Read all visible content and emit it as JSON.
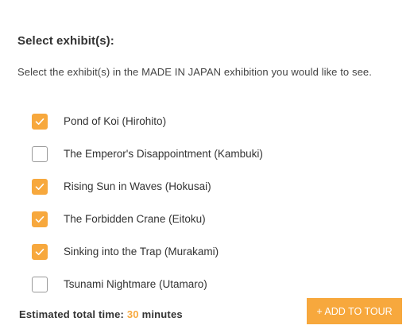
{
  "header": {
    "title": "Select exhibit(s):",
    "description": "Select the exhibit(s) in the MADE IN JAPAN exhibition you would like to see."
  },
  "exhibits": [
    {
      "label": "Pond of Koi (Hirohito)",
      "checked": true
    },
    {
      "label": "The Emperor's Disappointment (Kambuki)",
      "checked": false
    },
    {
      "label": "Rising Sun in Waves (Hokusai)",
      "checked": true
    },
    {
      "label": "The Forbidden Crane (Eitoku)",
      "checked": true
    },
    {
      "label": "Sinking into the Trap (Murakami)",
      "checked": true
    },
    {
      "label": "Tsunami Nightmare (Utamaro)",
      "checked": false
    }
  ],
  "footer": {
    "time_label": "Estimated total time:",
    "time_value": "30",
    "time_unit": "minutes",
    "add_button_label": "+ ADD TO TOUR"
  },
  "colors": {
    "accent": "#f7a83d",
    "checkbox_border": "#9a9a9a",
    "text": "#333333"
  },
  "icons": {
    "checked": "checkmark-icon"
  }
}
